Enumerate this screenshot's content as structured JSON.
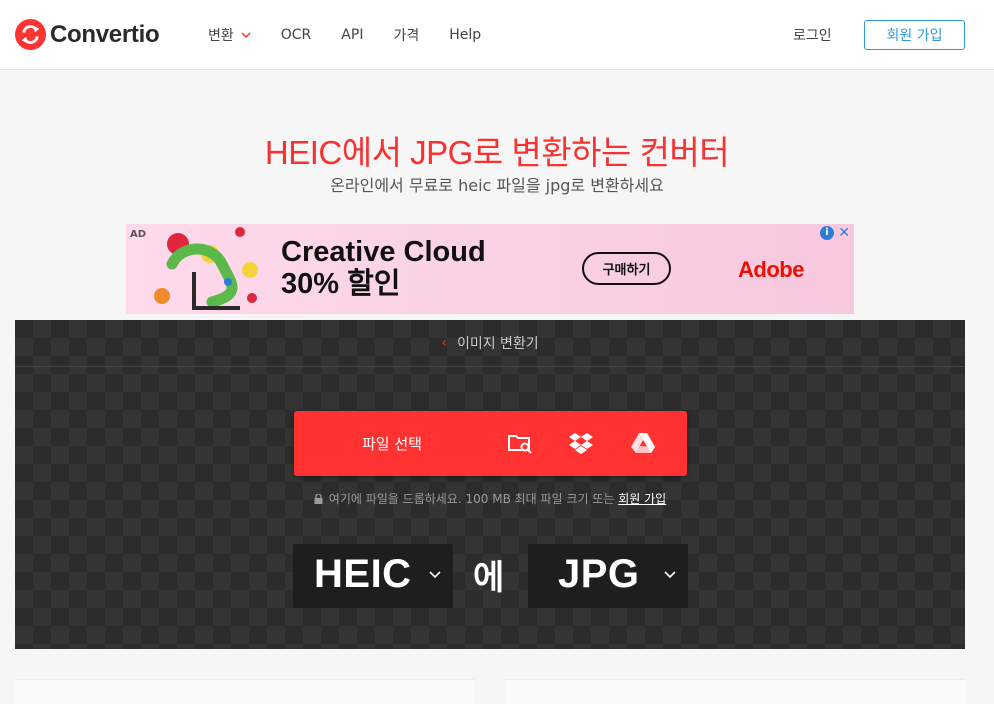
{
  "header": {
    "logo_text": "Convertio",
    "nav": [
      {
        "label": "변환",
        "has_dropdown": true
      },
      {
        "label": "OCR"
      },
      {
        "label": "API"
      },
      {
        "label": "가격"
      },
      {
        "label": "Help"
      }
    ],
    "login": "로그인",
    "signup": "회원 가입"
  },
  "hero": {
    "title": "HEIC에서 JPG로 변환하는 컨버터",
    "subtitle": "온라인에서 무료로 heic 파일을 jpg로 변환하세요"
  },
  "ad": {
    "badge": "AD",
    "headline_line1": "Creative Cloud",
    "headline_line2": "30% 할인",
    "cta": "구매하기",
    "brand": "Adobe",
    "info": "i",
    "close": "✕"
  },
  "converter": {
    "breadcrumb": "이미지 변환기",
    "upload_label": "파일 선택",
    "upload_icons": [
      "folder-search-icon",
      "dropbox-icon",
      "google-drive-icon"
    ],
    "note_text": "여기에 파일을 드롭하세요. 100 MB 최대 파일 크기 또는",
    "note_link": "회원 가입",
    "from_format": "HEIC",
    "to_word": "에",
    "to_format": "JPG"
  },
  "colors": {
    "brand_red": "#ff3131",
    "accent_blue": "#2d9bd8",
    "panel_dark": "#2c2c2c"
  }
}
